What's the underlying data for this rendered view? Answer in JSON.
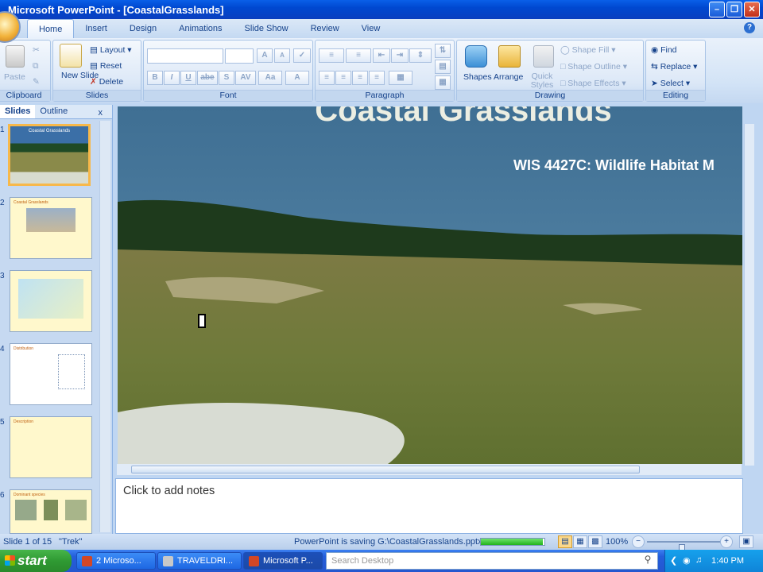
{
  "window": {
    "title": "Microsoft PowerPoint - [CoastalGrasslands]"
  },
  "tabs": [
    "Home",
    "Insert",
    "Design",
    "Animations",
    "Slide Show",
    "Review",
    "View"
  ],
  "ribbon": {
    "clipboard": {
      "paste": "Paste",
      "label": "Clipboard"
    },
    "slides": {
      "new_slide": "New Slide",
      "layout": "Layout",
      "reset": "Reset",
      "delete": "Delete",
      "label": "Slides"
    },
    "font": {
      "label": "Font",
      "buttons": [
        "B",
        "I",
        "U",
        "abe",
        "S",
        "AV",
        "Aa",
        "A"
      ],
      "grow": "A",
      "shrink": "A"
    },
    "paragraph": {
      "label": "Paragraph"
    },
    "drawing": {
      "shapes": "Shapes",
      "arrange": "Arrange",
      "quick_styles": "Quick Styles",
      "shape_fill": "Shape Fill",
      "shape_outline": "Shape Outline",
      "shape_effects": "Shape Effects",
      "label": "Drawing"
    },
    "editing": {
      "find": "Find",
      "replace": "Replace",
      "select": "Select",
      "label": "Editing"
    }
  },
  "pane": {
    "tab_slides": "Slides",
    "tab_outline": "Outline",
    "close": "x",
    "thumbnails": [
      {
        "num": "1",
        "title": "Coastal Grasslands"
      },
      {
        "num": "2",
        "title": "Coastal Grasslands"
      },
      {
        "num": "3",
        "title": ""
      },
      {
        "num": "4",
        "title": "Distribution"
      },
      {
        "num": "5",
        "title": "Description"
      },
      {
        "num": "6",
        "title": "Dominant species"
      }
    ]
  },
  "slide": {
    "title": "Coastal Grasslands",
    "subtitle": "WIS 4427C: Wildlife Habitat M"
  },
  "notes": {
    "placeholder": "Click to add notes"
  },
  "status": {
    "slide_info": "Slide 1 of 15",
    "theme": "\"Trek\"",
    "saving": "PowerPoint is saving G:\\CoastalGrasslands.pptx.",
    "progress": 0.98,
    "zoom": "100%"
  },
  "taskbar": {
    "start": "start",
    "tasks": [
      {
        "label": "2 Microso...",
        "active": false
      },
      {
        "label": "TRAVELDRI...",
        "active": false
      },
      {
        "label": "Microsoft P...",
        "active": true
      }
    ],
    "search_placeholder": "Search Desktop",
    "clock": "1:40 PM"
  },
  "colors": {
    "accent": "#15428b",
    "title_text": "#f2f2e6",
    "subtitle_text": "#ffffff"
  }
}
